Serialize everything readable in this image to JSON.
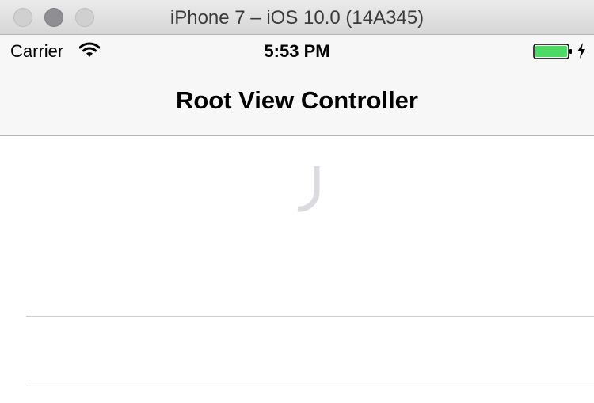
{
  "window": {
    "title": "iPhone 7 – iOS 10.0 (14A345)"
  },
  "status_bar": {
    "carrier": "Carrier",
    "time": "5:53 PM",
    "wifi_icon": "wifi-icon",
    "battery_icon": "battery-icon",
    "battery_color": "#4cd964",
    "charging_icon": "charging-bolt-icon"
  },
  "navigation_bar": {
    "title": "Root View Controller"
  },
  "content": {
    "loading_icon": "activity-spinner-icon",
    "table_rows": 2
  },
  "colors": {
    "titlebar": "#dcdcdc",
    "nav_background": "#f7f7f7",
    "separator": "#cdcdd1",
    "spinner": "#d9dbdf"
  }
}
